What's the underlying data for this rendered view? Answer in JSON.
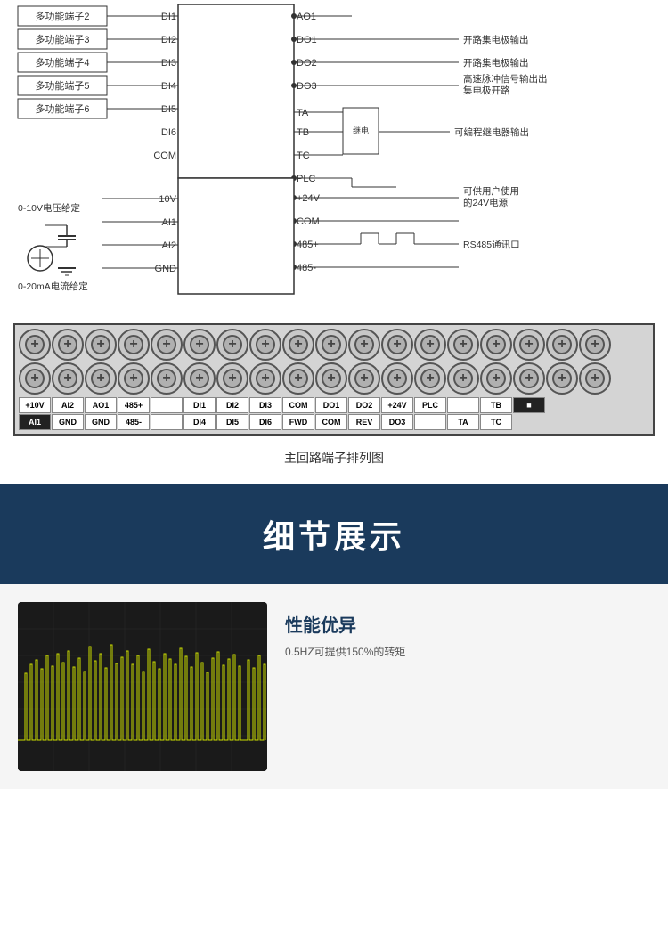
{
  "wiring": {
    "left_terminals": [
      "多功能端子2",
      "多功能端子3",
      "多功能端子4",
      "多功能端子5",
      "多功能端子6"
    ],
    "left_signals": [
      "DI1",
      "DI2",
      "DI3",
      "DI4",
      "DI5",
      "DI6",
      "COM"
    ],
    "right_outputs": [
      {
        "signal": "AO1",
        "label": ""
      },
      {
        "signal": "DO1",
        "label": "开路集电极输出"
      },
      {
        "signal": "DO2",
        "label": "开路集电极输出"
      },
      {
        "signal": "DO3",
        "label": "高速脉冲信号输出集电极开路"
      }
    ],
    "relay_outputs": [
      "TA",
      "TB",
      "TC"
    ],
    "relay_label": "可编程继电器输出",
    "power_signals": [
      {
        "signal": "PLC",
        "label": ""
      },
      {
        "signal": "+24V",
        "label": "可供用户使用的24V电源"
      },
      {
        "signal": "COM",
        "label": ""
      },
      {
        "signal": "485+",
        "label": "RS485通讯口"
      },
      {
        "signal": "485-",
        "label": ""
      }
    ],
    "left_analog": [
      {
        "signal": "10V",
        "label": "0-10V电压给定"
      },
      {
        "signal": "AI1",
        "label": ""
      },
      {
        "signal": "AI2",
        "label": ""
      },
      {
        "signal": "GND",
        "label": "0-20mA电流给定"
      }
    ]
  },
  "terminal_strip": {
    "top_row_count": 18,
    "bottom_row_count": 18,
    "top_labels": [
      "+10V",
      "AI2",
      "AO1",
      "485+",
      "",
      "DI1",
      "DI2",
      "DI3",
      "COM",
      "DO1",
      "DO2",
      "+24V",
      "PLC",
      "",
      "TB",
      "■"
    ],
    "bottom_labels": [
      "AI1",
      "GND",
      "GND",
      "485-",
      "",
      "DI4",
      "DI5",
      "DI6",
      "FWD",
      "COM",
      "REV",
      "DO3",
      "",
      "TA",
      "TC"
    ],
    "caption": "主回路端子排列图"
  },
  "detail_section": {
    "title": "细节展示"
  },
  "performance": {
    "title": "性能优异",
    "description": "0.5HZ可提供150%的转矩"
  }
}
